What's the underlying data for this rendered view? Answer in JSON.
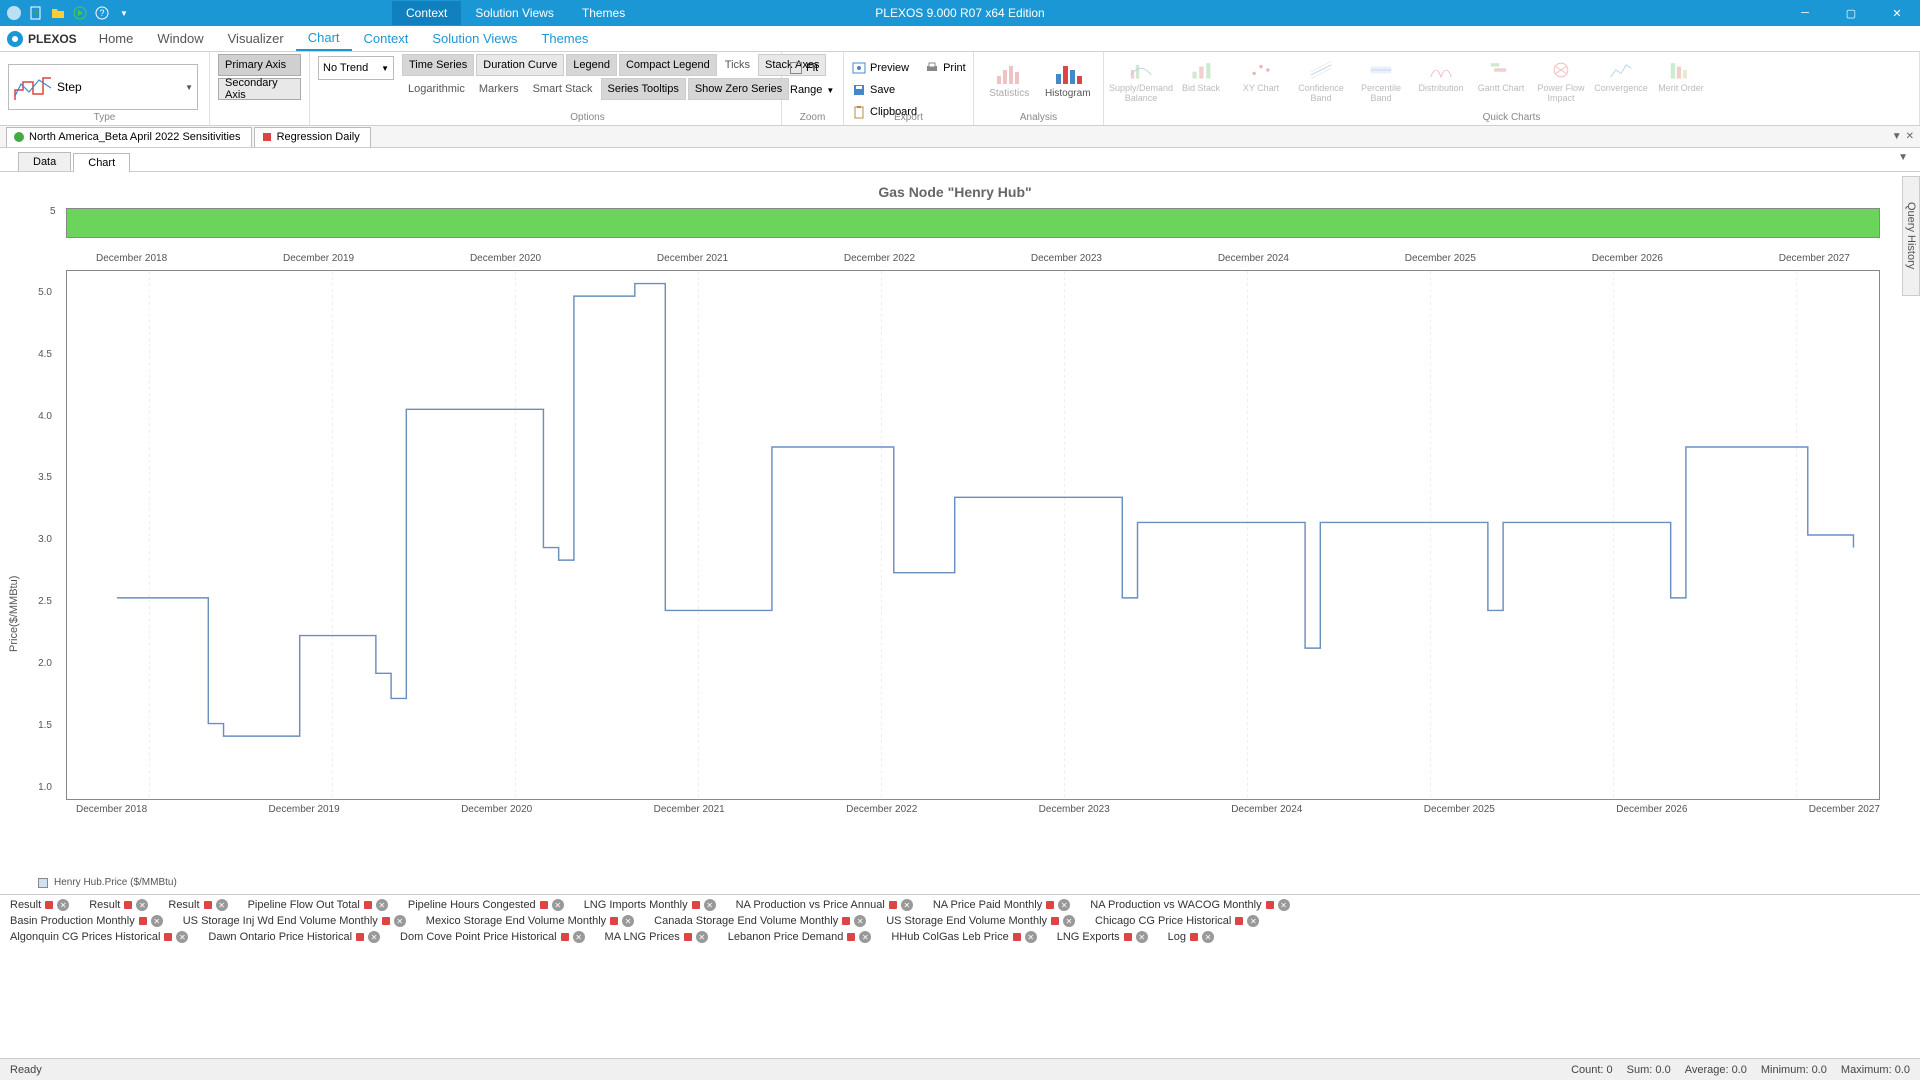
{
  "titlebar": {
    "title": "PLEXOS 9.000 R07 x64 Edition",
    "tabs": [
      "Context",
      "Solution Views",
      "Themes"
    ],
    "active_tab": 0
  },
  "menubar": {
    "logo": "PLEXOS",
    "items": [
      "Home",
      "Window",
      "Visualizer",
      "Chart",
      "Context",
      "Solution Views",
      "Themes"
    ],
    "active": "Chart"
  },
  "ribbon": {
    "type": {
      "label": "Type",
      "step": "Step"
    },
    "axis": {
      "primary": "Primary Axis",
      "secondary": "Secondary Axis"
    },
    "trend": "No Trend",
    "options": {
      "label": "Options",
      "row1": [
        "Time Series",
        "Duration Curve",
        "Legend",
        "Compact Legend",
        "Ticks",
        "Stack Axes"
      ],
      "row2": [
        "Logarithmic",
        "Markers",
        "Smart Stack",
        "Series Tooltips",
        "Show Zero Series"
      ],
      "selected": [
        "Time Series",
        "Legend",
        "Compact Legend",
        "Series Tooltips",
        "Show Zero Series"
      ]
    },
    "zoom": {
      "label": "Zoom",
      "items": [
        "Fit",
        "Range"
      ]
    },
    "export": {
      "label": "Export",
      "items": [
        "Preview",
        "Save",
        "Clipboard"
      ],
      "right": [
        "Print"
      ]
    },
    "analysis": {
      "label": "Analysis",
      "items": [
        "Statistics",
        "Histogram"
      ]
    },
    "quickcharts": {
      "label": "Quick Charts",
      "items": [
        "Supply/Demand Balance",
        "Bid Stack",
        "XY Chart",
        "Confidence Band",
        "Percentile Band",
        "Distribution",
        "Gantt Chart",
        "Power Flow Impact",
        "Convergence",
        "Merit Order"
      ]
    }
  },
  "doctabs": [
    "North America_Beta April 2022 Sensitivities",
    "Regression Daily"
  ],
  "subtabs": {
    "items": [
      "Data",
      "Chart"
    ],
    "active": "Chart"
  },
  "chart": {
    "title": "Gas Node \"Henry Hub\"",
    "yaxis_label": "Price($/MMBtu)",
    "overview_y": "5",
    "x_labels": [
      "December 2018",
      "December 2019",
      "December 2020",
      "December 2021",
      "December 2022",
      "December 2023",
      "December 2024",
      "December 2025",
      "December 2026",
      "December 2027"
    ],
    "y_labels": [
      "5.0",
      "4.5",
      "4.0",
      "3.5",
      "3.0",
      "2.5",
      "2.0",
      "1.5",
      "1.0"
    ],
    "legend": "Henry Hub.Price ($/MMBtu)"
  },
  "chart_data": {
    "type": "line",
    "title": "Gas Node \"Henry Hub\"",
    "xlabel": "",
    "ylabel": "Price($/MMBtu)",
    "ylim": [
      1.0,
      5.2
    ],
    "series": [
      {
        "name": "Henry Hub.Price ($/MMBtu)",
        "x": [
          "2018-06",
          "2018-12",
          "2019-01",
          "2019-06",
          "2019-11",
          "2019-12",
          "2020-01",
          "2020-06",
          "2020-10",
          "2020-11",
          "2020-12",
          "2021-04",
          "2021-06",
          "2021-12",
          "2022-01",
          "2022-06",
          "2022-09",
          "2022-12",
          "2023-01",
          "2023-06",
          "2023-12",
          "2024-01",
          "2024-06",
          "2024-12",
          "2025-01",
          "2025-06",
          "2025-12",
          "2026-01",
          "2026-06",
          "2026-12",
          "2027-01",
          "2027-06",
          "2027-09",
          "2027-12"
        ],
        "y": [
          2.6,
          1.6,
          1.5,
          2.3,
          2.0,
          1.8,
          4.1,
          4.1,
          3.0,
          2.9,
          5.0,
          5.1,
          2.5,
          2.5,
          3.8,
          3.8,
          2.8,
          2.8,
          3.4,
          3.4,
          2.6,
          3.2,
          3.2,
          2.2,
          3.2,
          3.2,
          2.5,
          3.2,
          3.2,
          2.6,
          3.8,
          3.8,
          3.1,
          3.0
        ]
      }
    ]
  },
  "bottom_tabs": {
    "row1": [
      "Result",
      "Result",
      "Result",
      "Pipeline Flow Out Total",
      "Pipeline Hours Congested",
      "LNG Imports Monthly",
      "NA Production  vs Price Annual",
      "NA Price Paid Monthly",
      "NA Production vs WACOG Monthly"
    ],
    "row2": [
      "Basin Production Monthly",
      "US Storage Inj Wd End Volume Monthly",
      "Mexico Storage End Volume Monthly",
      "Canada Storage End Volume Monthly",
      "US Storage End Volume Monthly",
      "Chicago CG Price Historical"
    ],
    "row3": [
      "Algonquin CG Prices Historical",
      "Dawn Ontario Price Historical",
      "Dom Cove Point Price Historical",
      "MA LNG Prices",
      "Lebanon Price Demand",
      "HHub ColGas Leb Price",
      "LNG Exports",
      "Log"
    ]
  },
  "statusbar": {
    "left": "Ready",
    "right": [
      "Count: 0",
      "Sum: 0.0",
      "Average: 0.0",
      "Minimum: 0.0",
      "Maximum: 0.0"
    ]
  },
  "side_panel": "Query History"
}
